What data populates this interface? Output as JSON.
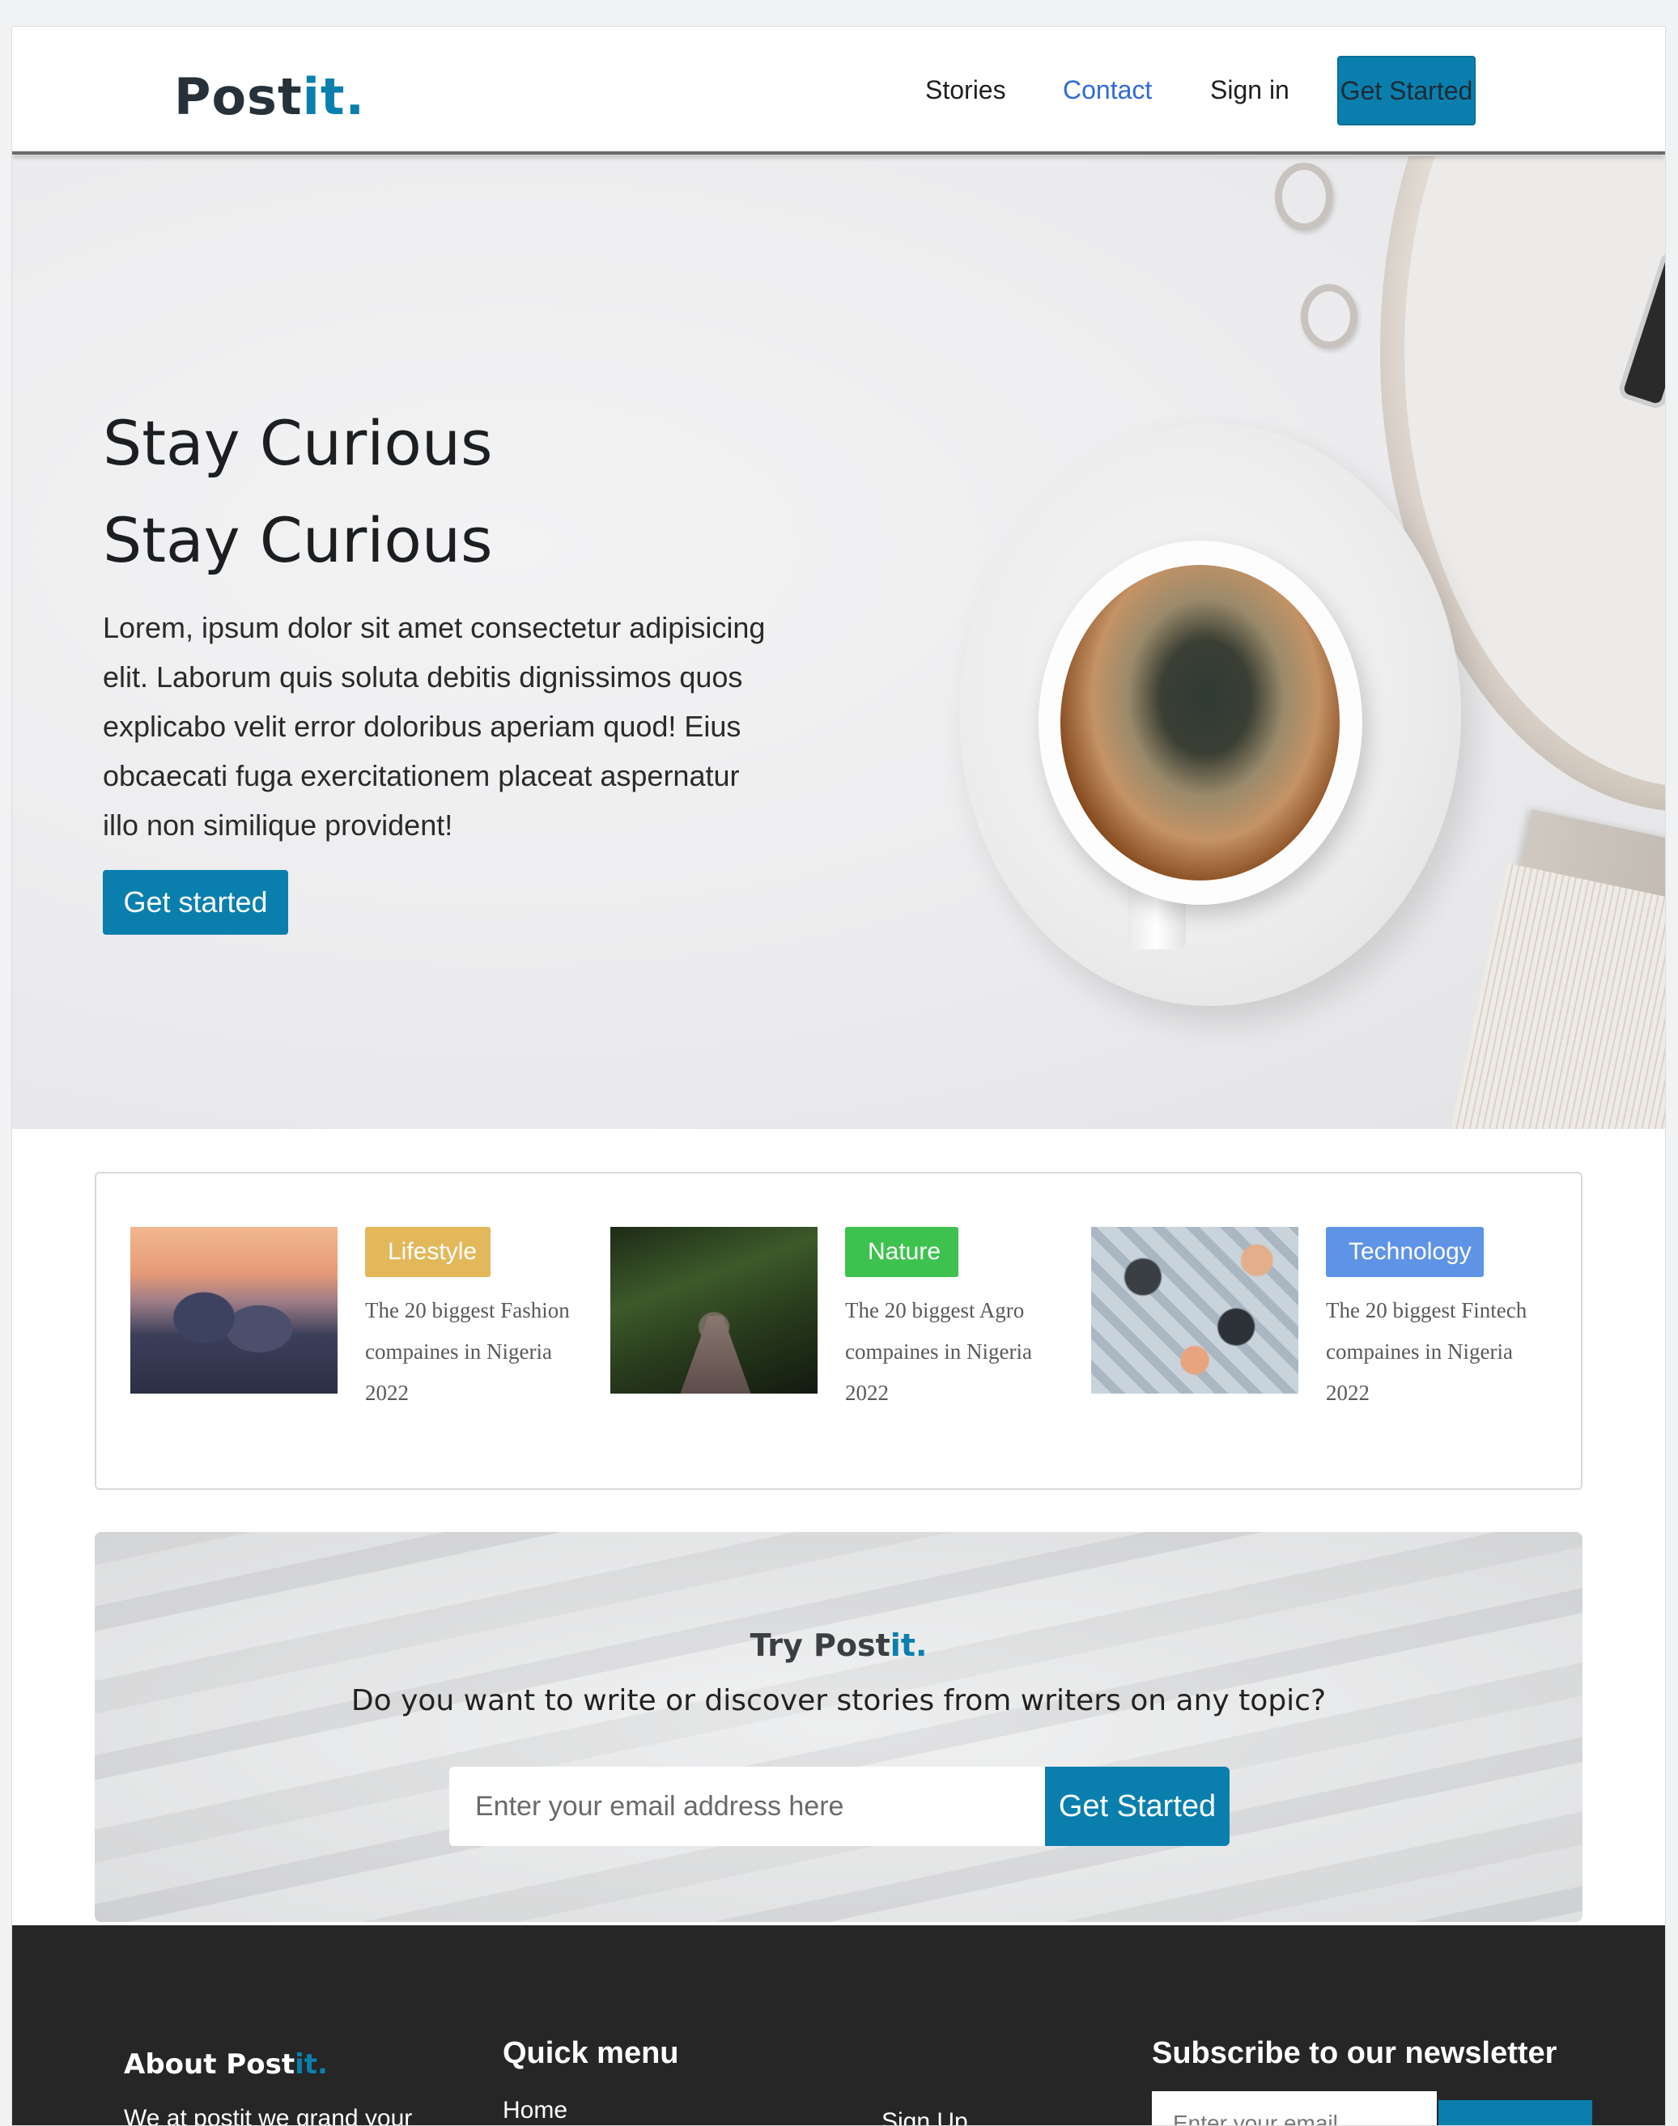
{
  "navbar": {
    "logo_main": "Post",
    "logo_accent": "it.",
    "links": {
      "stories": "Stories",
      "contact": "Contact",
      "signin": "Sign in"
    },
    "cta": "Get Started"
  },
  "hero": {
    "title_line1": "Stay Curious",
    "title_line2": "Stay Curious",
    "text": "Lorem, ipsum dolor sit amet consectetur adipisicing elit. Laborum quis soluta debitis dignissimos quos explicabo velit error doloribus aperiam quod! Eius obcaecati fuga exercitationem placeat aspernatur illo non similique provident!",
    "button": "Get started"
  },
  "categories": [
    {
      "badge": "Lifestyle",
      "text": "The 20 biggest Fashion compaines in Nigeria 2022",
      "color": "#e3b85b"
    },
    {
      "badge": "Nature",
      "text": "The 20 biggest Agro compaines in Nigeria 2022",
      "color": "#3ec24f"
    },
    {
      "badge": "Technology",
      "text": "The 20 biggest Fintech compaines in Nigeria 2022",
      "color": "#5f93e6"
    }
  ],
  "try_section": {
    "title_main": "Try Post",
    "title_accent": "it.",
    "subtitle": "Do you want to write or discover stories from writers on any topic?",
    "email_placeholder": "Enter your email address here",
    "button": "Get Started"
  },
  "footer": {
    "about_title_main": "About Post",
    "about_title_accent": "it.",
    "about_text": "We at postit we grand your",
    "quick_menu_title": "Quick menu",
    "quick_menu_items": [
      "Home",
      "Sign Up"
    ],
    "newsletter_title": "Subscribe to our newsletter",
    "newsletter_placeholder": "Enter your email"
  },
  "colors": {
    "brand": "#0a7fae",
    "link": "#2f6bd9",
    "footer_bg": "#262626"
  }
}
